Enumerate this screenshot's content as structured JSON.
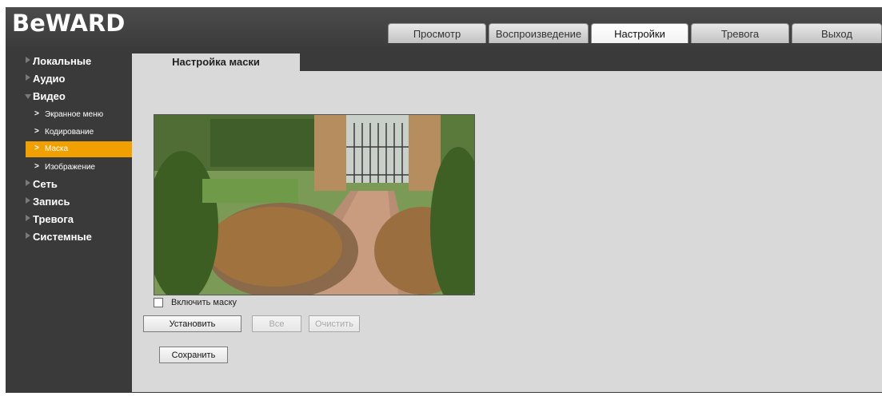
{
  "app": {
    "logo_text": "BeWARD"
  },
  "tabs": [
    {
      "label": "Просмотр",
      "active": false
    },
    {
      "label": "Воспроизведение",
      "active": false
    },
    {
      "label": "Настройки",
      "active": true
    },
    {
      "label": "Тревога",
      "active": false
    },
    {
      "label": "Выход",
      "active": false
    }
  ],
  "sidebar": {
    "items": [
      {
        "label": "Локальные",
        "expanded": false
      },
      {
        "label": "Аудио",
        "expanded": false
      },
      {
        "label": "Видео",
        "expanded": true
      },
      {
        "label": "Экранное меню",
        "sub": true
      },
      {
        "label": "Кодирование",
        "sub": true
      },
      {
        "label": "Маска",
        "sub": true,
        "active": true
      },
      {
        "label": "Изображение",
        "sub": true
      },
      {
        "label": "Сеть",
        "expanded": false
      },
      {
        "label": "Запись",
        "expanded": false
      },
      {
        "label": "Тревога",
        "expanded": false
      },
      {
        "label": "Системные",
        "expanded": false
      }
    ]
  },
  "main": {
    "section_title": "Настройка маски",
    "enable_mask_label": "Включить маску",
    "enable_mask_checked": false,
    "buttons": {
      "set": "Установить",
      "all": "Все",
      "clear": "Очистить",
      "save": "Сохранить"
    }
  },
  "colors": {
    "accent": "#f0a000",
    "active_tab_bg": "#ffffff"
  }
}
